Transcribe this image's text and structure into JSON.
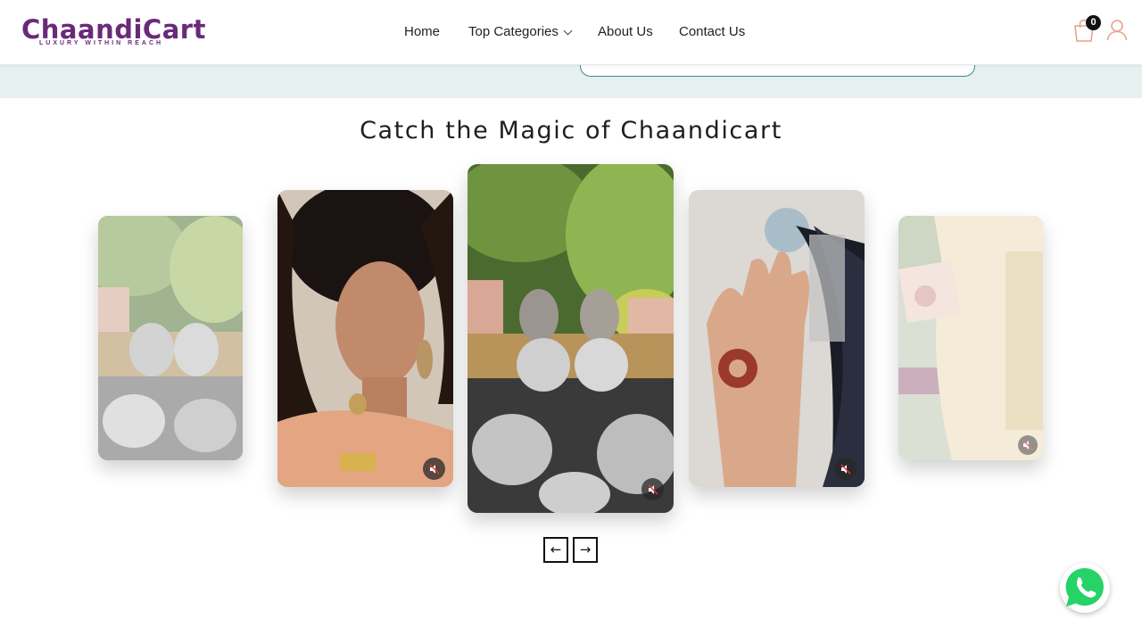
{
  "brand": {
    "name": "ChaandiCart",
    "tagline": "LUXURY WITHIN REACH",
    "color": "#6a2a7a"
  },
  "nav": {
    "home": "Home",
    "categories": "Top Categories",
    "about": "About Us",
    "contact": "Contact Us"
  },
  "cart": {
    "count": "0",
    "icon": "shopping-bag-icon"
  },
  "user": {
    "icon": "user-icon"
  },
  "section": {
    "title": "Catch the Magic of Chaandicart"
  },
  "carousel": {
    "prev_label": "←",
    "next_label": "→",
    "cards": [
      {
        "name": "video-card-jhumkas-basket",
        "muted": true
      },
      {
        "name": "video-card-model-earrings",
        "muted": true
      },
      {
        "name": "video-card-jhumkas-closeup",
        "muted": true
      },
      {
        "name": "video-card-henna-hand",
        "muted": true
      },
      {
        "name": "video-card-embroidered-dress",
        "muted": true
      }
    ]
  },
  "whatsapp": {
    "icon": "whatsapp-icon",
    "color": "#25d366"
  },
  "colors": {
    "strip": "#e6f0ee",
    "accent": "#3a8a86"
  }
}
